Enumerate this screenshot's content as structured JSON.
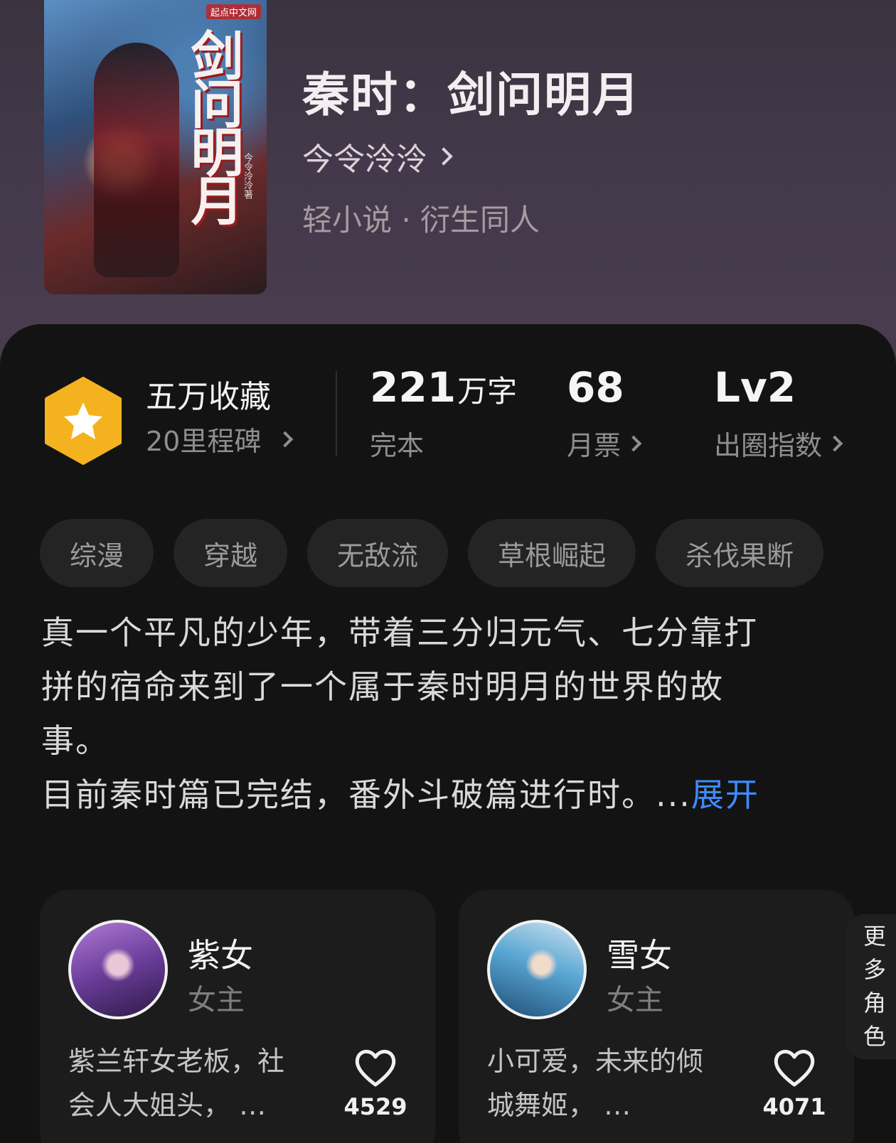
{
  "book": {
    "title": "秦时：剑问明月",
    "author": "今令泠泠",
    "genre": "轻小说 · 衍生同人",
    "cover": {
      "publisher": "起点中文网",
      "title": "剑问明月",
      "author_credit": "今令泠泠著"
    }
  },
  "stats": {
    "favorites": "五万收藏",
    "milestone": "20里程碑",
    "words_value": "221",
    "words_unit": "万字",
    "status": "完本",
    "monthly_votes": "68",
    "monthly_votes_label": "月票",
    "level": "Lv2",
    "level_label": "出圈指数"
  },
  "tags": [
    "综漫",
    "穿越",
    "无敌流",
    "草根崛起",
    "杀伐果断"
  ],
  "synopsis": {
    "line1": "真一个平凡的少年，带着三分归元气、七分靠打",
    "line2": "拼的宿命来到了一个属于秦时明月的世界的故",
    "line3": "事。",
    "line4": "目前秦时篇已完结，番外斗破篇进行时。...",
    "expand": "展开"
  },
  "characters": [
    {
      "name": "紫女",
      "role": "女主",
      "desc1": "紫兰轩女老板，社",
      "desc2": "会人大姐头， …",
      "likes": "4529"
    },
    {
      "name": "雪女",
      "role": "女主",
      "desc1": "小可爱，未来的倾",
      "desc2": "城舞姬， …",
      "likes": "4071"
    }
  ],
  "more_roles": [
    "更",
    "多",
    "角",
    "色"
  ],
  "colors": {
    "accent_link": "#3d8bff",
    "badge_gold": "#f5b21f",
    "background": "#131313",
    "header": "#43394a"
  }
}
